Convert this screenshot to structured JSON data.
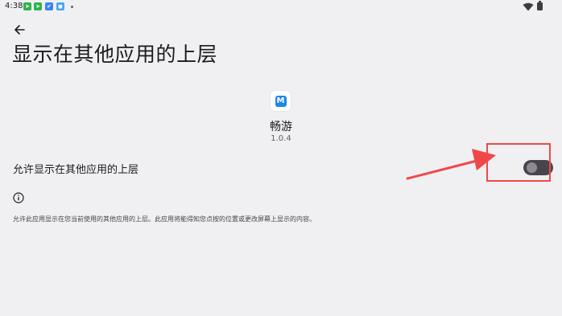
{
  "status_bar": {
    "time": "4:38",
    "notification_icons": [
      {
        "name": "green-app-icon-1",
        "color": "#2fb34a"
      },
      {
        "name": "green-app-icon-2",
        "color": "#2fb34a"
      },
      {
        "name": "blue-app-icon-1",
        "color": "#3b82f6"
      },
      {
        "name": "blue-app-icon-2",
        "color": "#42a5f5"
      }
    ],
    "icons": [
      "wifi-icon",
      "battery-icon"
    ]
  },
  "header": {
    "back_icon": "arrow-left-icon",
    "title": "显示在其他应用的上层"
  },
  "app": {
    "icon": "app-m-icon",
    "icon_letter": "M",
    "icon_color": "#1e88e5",
    "name": "畅游",
    "version": "1.0.4"
  },
  "permission": {
    "label": "允许显示在其他应用的上层",
    "toggle_state": "off"
  },
  "info": {
    "icon": "info-icon",
    "description": "允许此应用显示在您当前使用的其他应用的上层。此应用将能得知您点按的位置或更改屏幕上显示的内容。"
  },
  "annotation": {
    "color": "#f04848",
    "target": "toggle-switch"
  }
}
